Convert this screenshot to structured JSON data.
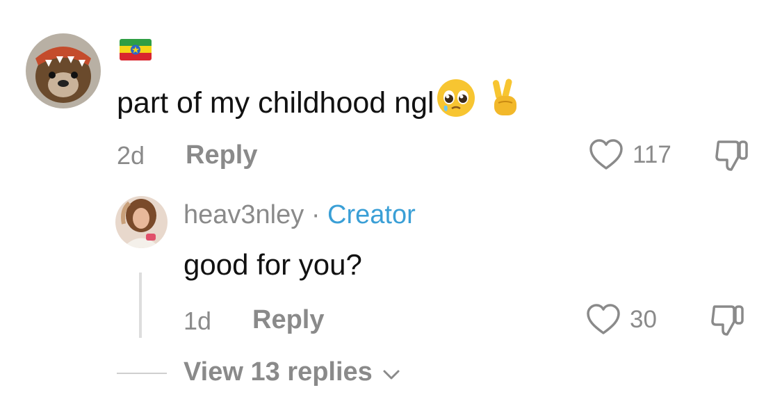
{
  "comment": {
    "text": "part of my childhood ngl",
    "emojis": [
      "pleading-face",
      "victory-hand"
    ],
    "flag_icon": "ethiopia-flag",
    "age": "2d",
    "reply_label": "Reply",
    "likes": "117"
  },
  "reply": {
    "username": "heav3nley",
    "separator": "·",
    "badge": "Creator",
    "text": "good for you?",
    "age": "1d",
    "reply_label": "Reply",
    "likes": "30"
  },
  "thread": {
    "view_replies_label": "View 13 replies"
  },
  "colors": {
    "meta_gray": "#8a8a8a",
    "creator_blue": "#3a9fd6",
    "text": "#111111"
  }
}
